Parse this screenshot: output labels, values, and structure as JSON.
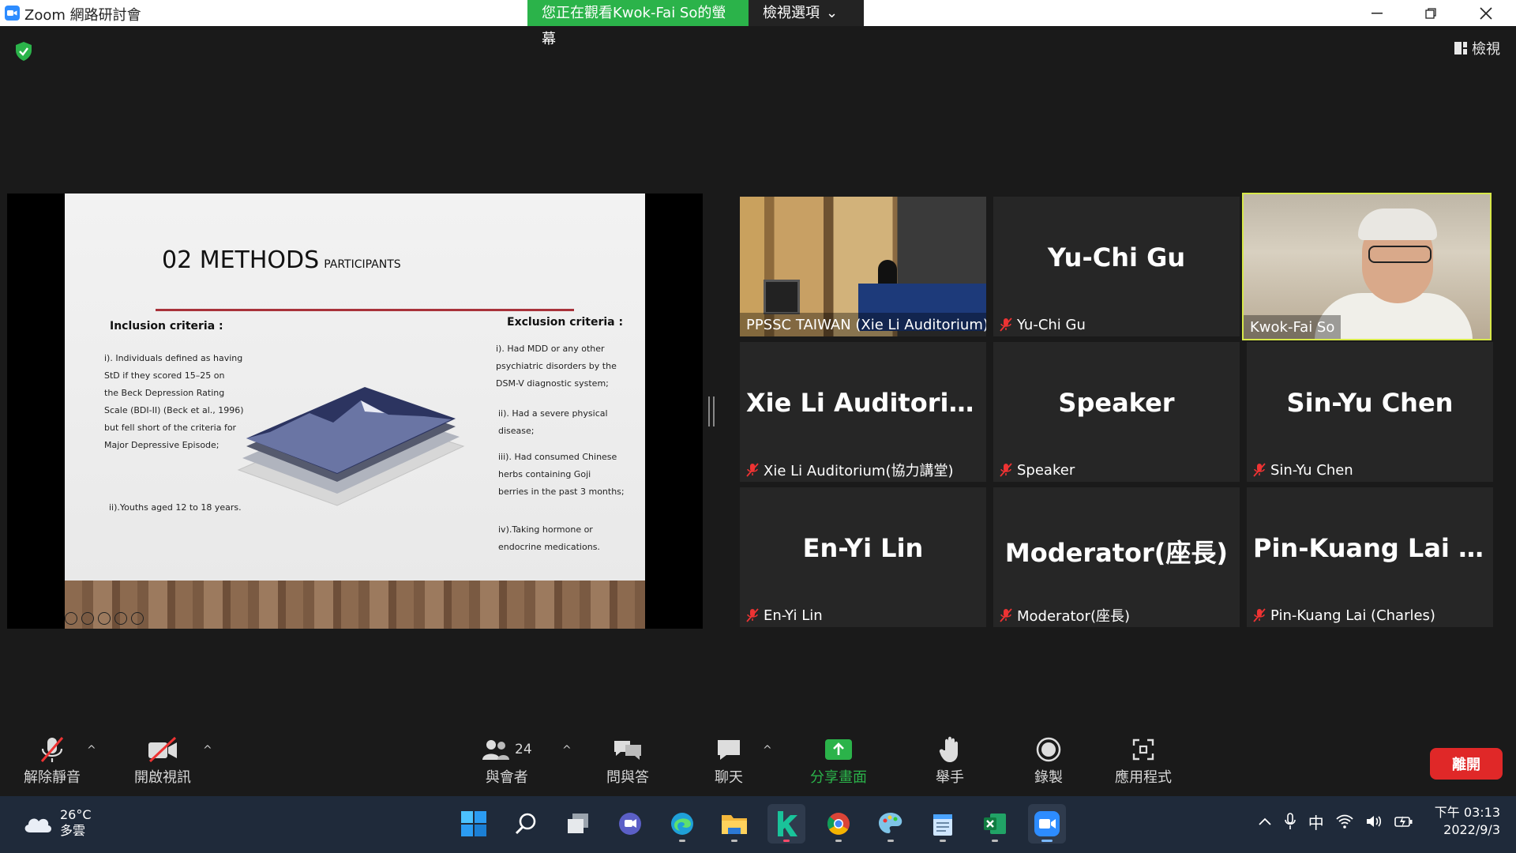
{
  "window": {
    "title": "Zoom 網路研討會",
    "share_banner": "您正在觀看Kwok-Fai So的螢幕",
    "view_options": "檢視選項",
    "view_label": "檢視"
  },
  "slide": {
    "title": "02 METHODS",
    "subtitle": "PARTICIPANTS",
    "inclusion_title": "Inclusion criteria :",
    "inclusion_1": [
      "i). Individuals defined as having",
      "StD if they scored 15–25 on",
      "the Beck Depression Rating",
      "Scale (BDI-II) (Beck et al., 1996)",
      "but fell short of the criteria for",
      "Major Depressive Episode;"
    ],
    "inclusion_2": "ii).Youths aged 12 to 18 years.",
    "exclusion_title": "Exclusion criteria :",
    "exclusion_1": [
      "i). Had MDD or any other",
      "psychiatric disorders by the",
      "DSM-V diagnostic system;"
    ],
    "exclusion_2": [
      "ii). Had a severe physical",
      "disease;"
    ],
    "exclusion_3": [
      "iii). Had consumed Chinese",
      "herbs containing Goji",
      "berries in the past 3 months;"
    ],
    "exclusion_4": [
      "iv).Taking hormone or",
      "endocrine medications."
    ]
  },
  "participants": [
    {
      "big": "",
      "label": "PPSSC TAIWAN (Xie Li Auditorium)",
      "muted": false,
      "video": "room"
    },
    {
      "big": "Yu-Chi Gu",
      "label": "Yu-Chi Gu",
      "muted": true
    },
    {
      "big": "",
      "label": "Kwok-Fai So",
      "muted": false,
      "video": "face",
      "active": true
    },
    {
      "big": "Xie Li Auditoriu...",
      "label": "Xie Li Auditorium(協力講堂)",
      "muted": true
    },
    {
      "big": "Speaker",
      "label": "Speaker",
      "muted": true
    },
    {
      "big": "Sin-Yu Chen",
      "label": "Sin-Yu Chen",
      "muted": true
    },
    {
      "big": "En-Yi Lin",
      "label": "En-Yi Lin",
      "muted": true
    },
    {
      "big": "Moderator(座長)",
      "label": "Moderator(座長)",
      "muted": true
    },
    {
      "big": "Pin-Kuang Lai (...",
      "label": "Pin-Kuang Lai (Charles)",
      "muted": true
    }
  ],
  "toolbar": {
    "unmute": "解除靜音",
    "start_video": "開啟視訊",
    "participants": "與會者",
    "participant_count": "24",
    "qa": "問與答",
    "chat": "聊天",
    "share": "分享畫面",
    "raise_hand": "舉手",
    "record": "錄製",
    "apps": "應用程式",
    "leave": "離開"
  },
  "taskbar": {
    "temp": "26°C",
    "weather": "多雲",
    "ime": "中",
    "time": "下午 03:13",
    "date": "2022/9/3"
  },
  "colors": {
    "share_green": "#2bb34a",
    "leave_red": "#e02828",
    "active_speaker": "#d7e84a"
  }
}
